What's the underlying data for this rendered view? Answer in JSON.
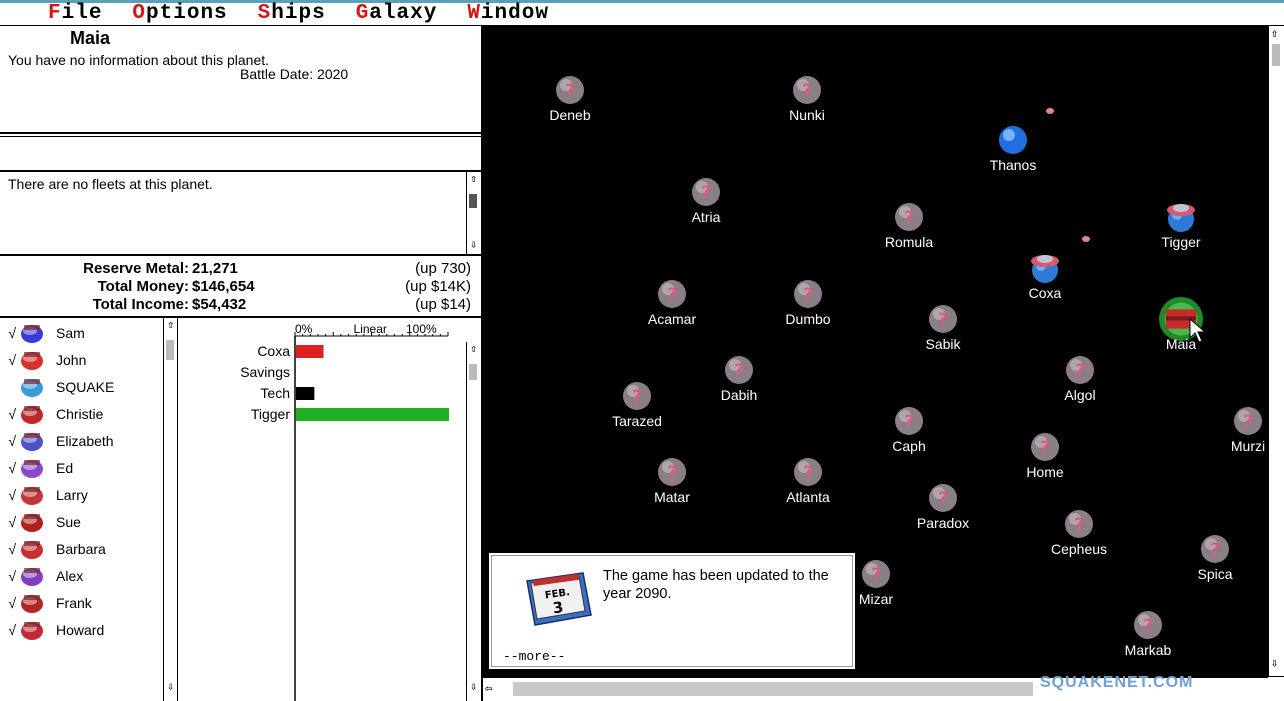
{
  "menu": {
    "items": [
      {
        "accel": "F",
        "rest": "ile"
      },
      {
        "accel": "O",
        "rest": "ptions"
      },
      {
        "accel": "S",
        "rest": "hips"
      },
      {
        "accel": "G",
        "rest": "alaxy"
      },
      {
        "accel": "W",
        "rest": "indow"
      }
    ]
  },
  "planet_info": {
    "name": "Maia",
    "description": "You have no information about this planet.",
    "battle_date": "Battle Date: 2020"
  },
  "fleets": {
    "text": "There are no fleets at this planet."
  },
  "stats": {
    "reserve_metal": {
      "label": "Reserve Metal:",
      "value": "21,271",
      "change": "(up 730)"
    },
    "total_money": {
      "label": "Total Money:",
      "value": "$146,654",
      "change": "(up $14K)"
    },
    "total_income": {
      "label": "Total Income:",
      "value": "$54,432",
      "change": "(up $14)"
    }
  },
  "players": [
    {
      "name": "Sam",
      "checked": true,
      "color": "#3a3ad8"
    },
    {
      "name": "John",
      "checked": true,
      "color": "#d83030"
    },
    {
      "name": "SQUAKE",
      "checked": false,
      "color": "#3a9ad8"
    },
    {
      "name": "Christie",
      "checked": true,
      "color": "#c02828"
    },
    {
      "name": "Elizabeth",
      "checked": true,
      "color": "#5050c8"
    },
    {
      "name": "Ed",
      "checked": true,
      "color": "#8a4ac8"
    },
    {
      "name": "Larry",
      "checked": true,
      "color": "#c03838"
    },
    {
      "name": "Sue",
      "checked": true,
      "color": "#b02020"
    },
    {
      "name": "Barbara",
      "checked": true,
      "color": "#c83030"
    },
    {
      "name": "Alex",
      "checked": true,
      "color": "#8040c0"
    },
    {
      "name": "Frank",
      "checked": true,
      "color": "#b02828"
    },
    {
      "name": "Howard",
      "checked": true,
      "color": "#c02838"
    }
  ],
  "chart_data": {
    "type": "bar",
    "orientation": "horizontal",
    "scale_label": "Linear",
    "tick_labels": [
      "0%",
      "100%"
    ],
    "xlim": [
      0,
      100
    ],
    "categories": [
      "Coxa",
      "Savings",
      "Tech",
      "Tigger"
    ],
    "values": [
      18,
      0,
      12,
      100
    ],
    "colors": [
      "#e02020",
      "#000000",
      "#000000",
      "#20b020"
    ]
  },
  "planets": [
    {
      "name": "Deneb",
      "type": "unknown"
    },
    {
      "name": "Nunki",
      "type": "unknown"
    },
    {
      "name": "Thanos",
      "type": "blue"
    },
    {
      "name": "Atria",
      "type": "unknown"
    },
    {
      "name": "Romula",
      "type": "unknown"
    },
    {
      "name": "Tigger",
      "type": "owned"
    },
    {
      "name": "Coxa",
      "type": "owned"
    },
    {
      "name": "Acamar",
      "type": "unknown"
    },
    {
      "name": "Dumbo",
      "type": "unknown"
    },
    {
      "name": "Sabik",
      "type": "unknown"
    },
    {
      "name": "Maia",
      "type": "selected"
    },
    {
      "name": "Dabih",
      "type": "unknown"
    },
    {
      "name": "Algol",
      "type": "unknown"
    },
    {
      "name": "Tarazed",
      "type": "unknown"
    },
    {
      "name": "Caph",
      "type": "unknown"
    },
    {
      "name": "Home",
      "type": "unknown"
    },
    {
      "name": "Murzi",
      "type": "unknown"
    },
    {
      "name": "Matar",
      "type": "unknown"
    },
    {
      "name": "Atlanta",
      "type": "unknown"
    },
    {
      "name": "Paradox",
      "type": "unknown"
    },
    {
      "name": "Cepheus",
      "type": "unknown"
    },
    {
      "name": "Mizar",
      "type": "unknown"
    },
    {
      "name": "Spica",
      "type": "unknown"
    },
    {
      "name": "Markab",
      "type": "unknown"
    }
  ],
  "message": {
    "text": "The game has been updated to the year 2090.",
    "more": "--more--",
    "calendar_month": "FEB.",
    "calendar_day": "3"
  },
  "watermark": "SQUAKENET.COM",
  "colors": {
    "background_space": "#000000",
    "menu_accel": "#d01818",
    "unknown_planet": "#8a7f86",
    "question_mark": "#e05a7a"
  }
}
